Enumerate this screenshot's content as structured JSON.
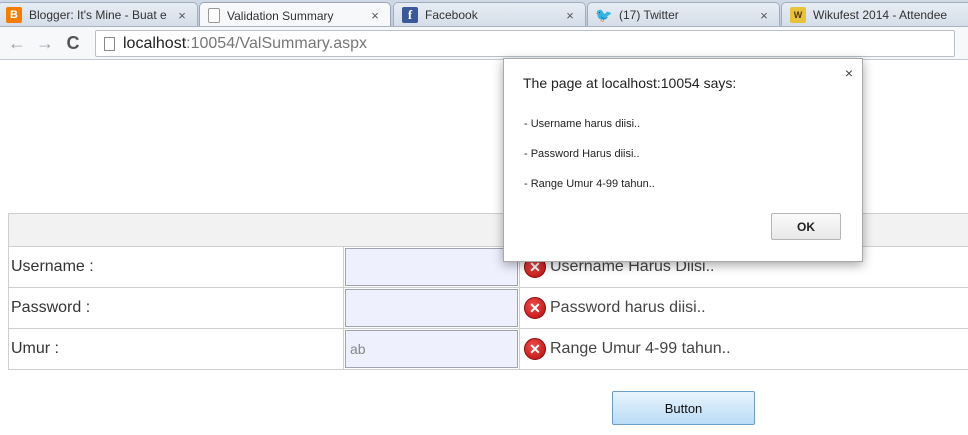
{
  "browser": {
    "tabs": [
      {
        "title": "Blogger: It's Mine - Buat e",
        "icon": "blogger-icon",
        "glyph": "B"
      },
      {
        "title": "Validation Summary",
        "icon": "page-icon",
        "glyph": ""
      },
      {
        "title": "Facebook",
        "icon": "facebook-icon",
        "glyph": "f"
      },
      {
        "title": "(17) Twitter",
        "icon": "twitter-icon",
        "glyph": "🐦"
      },
      {
        "title": "Wikufest 2014 - Attendee",
        "icon": "wikufest-icon",
        "glyph": "W"
      }
    ],
    "tab_close_glyph": "×",
    "back_glyph": "←",
    "forward_glyph": "→",
    "reload_glyph": "C",
    "url_host": "localhost",
    "url_rest": ":10054/ValSummary.aspx"
  },
  "form": {
    "rows": [
      {
        "label": "Username :",
        "value": "",
        "error": "Username Harus Diisi.."
      },
      {
        "label": "Password :",
        "value": "",
        "error": "Password harus diisi.."
      },
      {
        "label": "Umur :",
        "value": "ab",
        "error": "Range Umur 4-99 tahun.."
      }
    ],
    "error_glyph": "✕",
    "button_label": "Button"
  },
  "dialog": {
    "title": "The page at localhost:10054 says:",
    "messages": [
      "- Username harus diisi..",
      "- Password Harus diisi..",
      "- Range Umur 4-99 tahun.."
    ],
    "ok_label": "OK",
    "close_glyph": "×"
  }
}
